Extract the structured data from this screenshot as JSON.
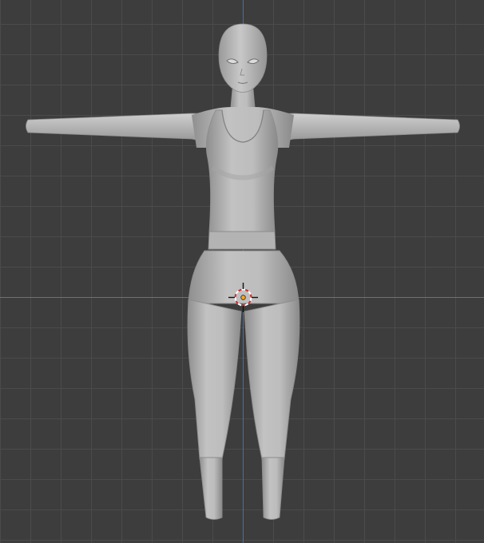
{
  "viewport": {
    "view": "front-orthographic",
    "background_color": "#3d3d3d",
    "grid_color": "#4a4a4a",
    "x_axis_color": "#c94a4f",
    "z_axis_color": "#3f6fb5",
    "mesh_color": "#b9b9b9"
  },
  "scene": {
    "model": "female-base-mesh",
    "pose": "T-pose",
    "cursor": "3d-cursor-icon",
    "origin": "object-origin-dot"
  }
}
